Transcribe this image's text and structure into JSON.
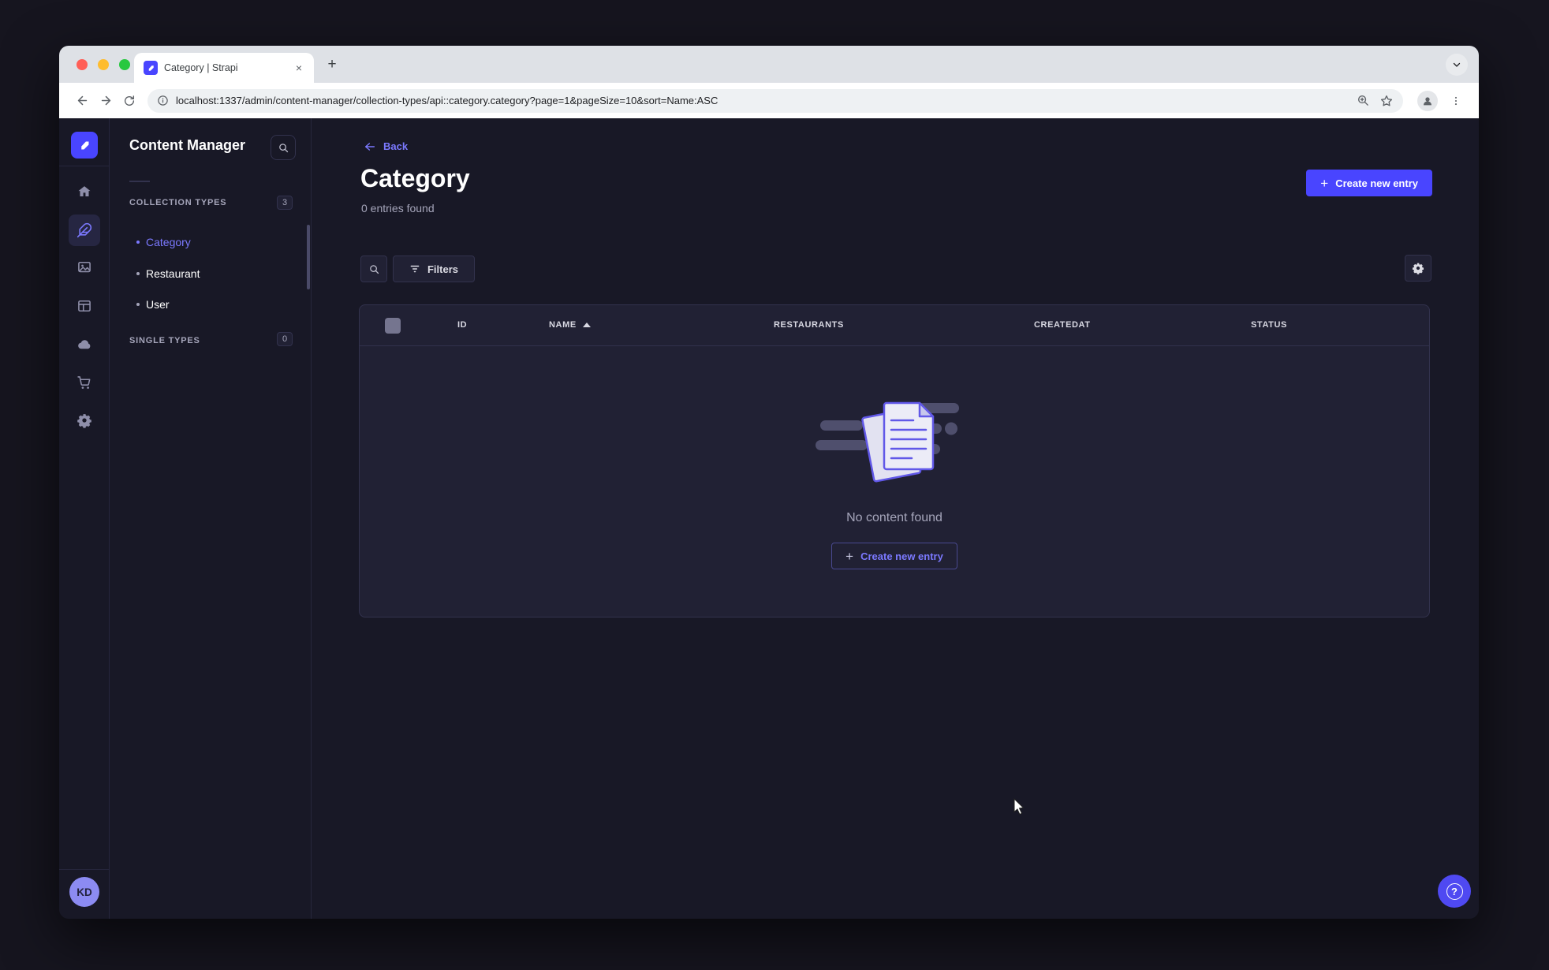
{
  "browser": {
    "tab_title": "Category | Strapi",
    "url": "localhost:1337/admin/content-manager/collection-types/api::category.category?page=1&pageSize=10&sort=Name:ASC"
  },
  "sidebar": {
    "icons": [
      "strapi-logo",
      "home",
      "content-manager",
      "media-library",
      "content-type-builder",
      "cloud",
      "marketplace",
      "settings"
    ],
    "avatar_initials": "KD"
  },
  "nav": {
    "title": "Content Manager",
    "collection_types_label": "COLLECTION TYPES",
    "collection_types_count": "3",
    "items": [
      {
        "label": "Category",
        "active": true
      },
      {
        "label": "Restaurant",
        "active": false
      },
      {
        "label": "User",
        "active": false
      }
    ],
    "single_types_label": "SINGLE TYPES",
    "single_types_count": "0"
  },
  "main": {
    "back_label": "Back",
    "title": "Category",
    "subtitle": "0 entries found",
    "create_button_label": "Create new entry",
    "filters_label": "Filters",
    "table_headers": [
      "ID",
      "NAME",
      "RESTAURANTS",
      "CREATEDAT",
      "STATUS"
    ],
    "empty_message": "No content found",
    "empty_create_button_label": "Create new entry"
  },
  "colors": {
    "primary": "#4945ff",
    "primary_light": "#7b79ff",
    "page_bg": "#181826",
    "card_bg": "#212134",
    "border": "#32324d",
    "text_muted": "#a5a5ba"
  }
}
